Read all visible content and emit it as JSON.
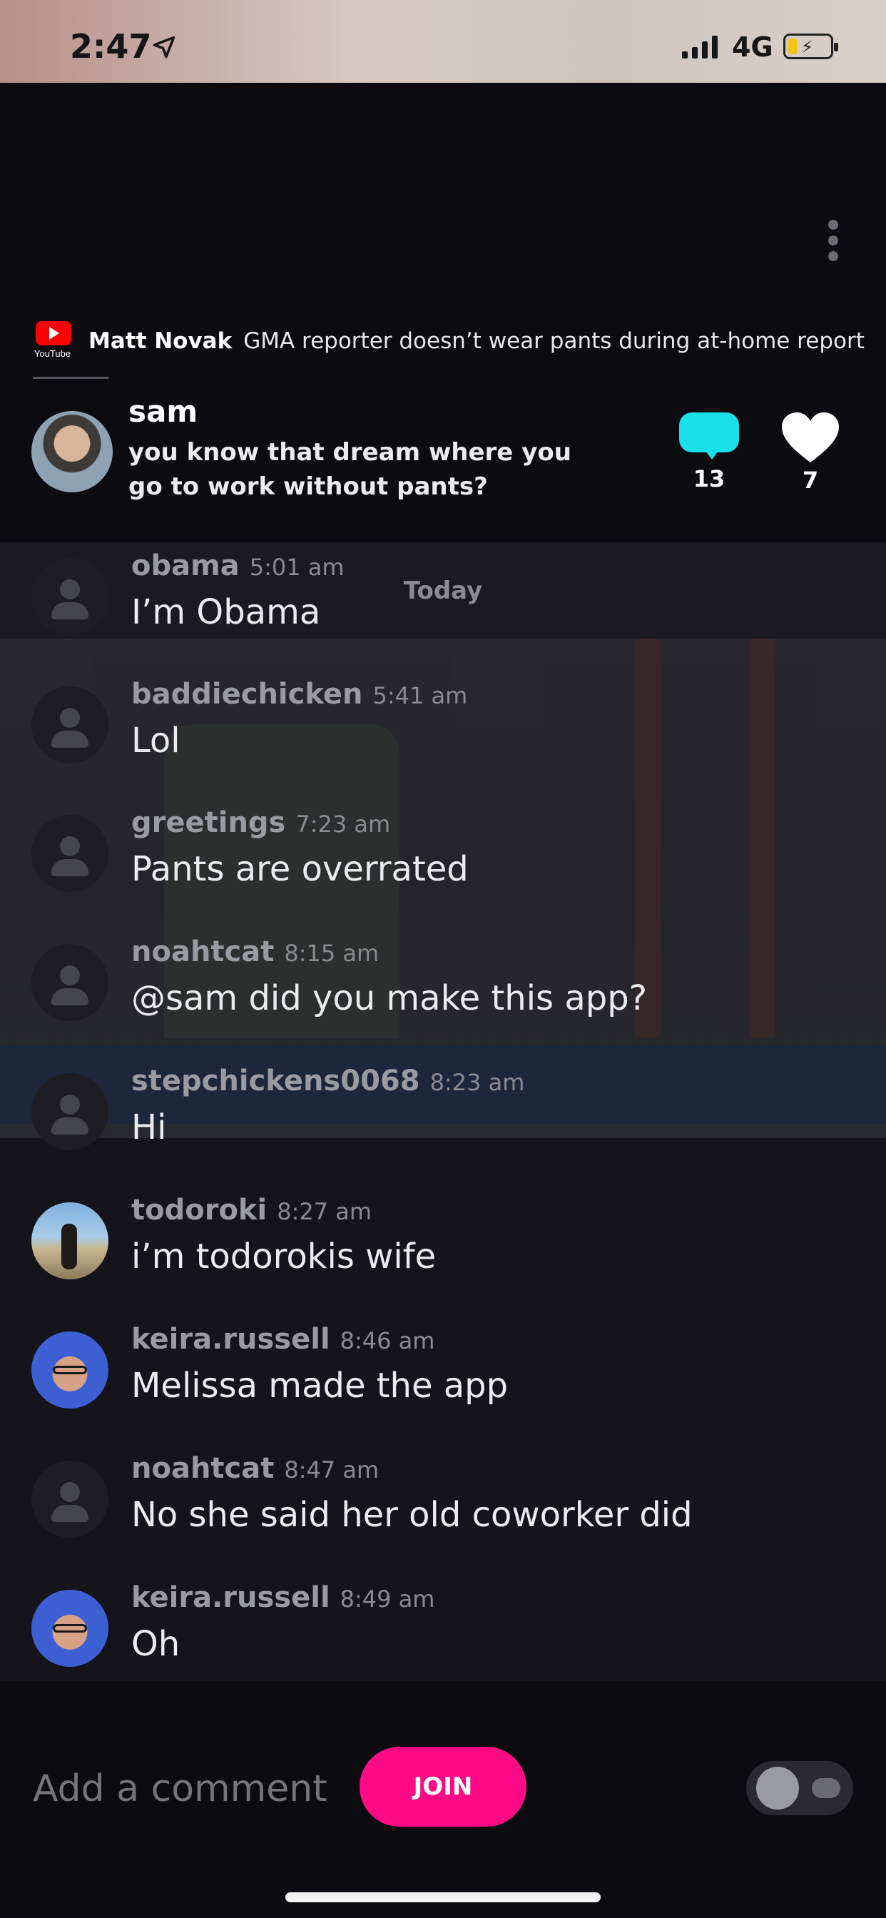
{
  "status_bar": {
    "time": "2:47",
    "network": "4G",
    "battery_level": 0.2
  },
  "source": {
    "platform_label": "YouTube",
    "author": "Matt Novak",
    "title": "GMA reporter doesn’t wear pants during at-home report"
  },
  "post": {
    "user": "sam",
    "text": "you know that dream where you go to work without pants?",
    "comment_count": "13",
    "like_count": "7"
  },
  "chat": {
    "day_label": "Today",
    "messages": [
      {
        "user": "obama",
        "time": "5:01 am",
        "text": "I’m Obama"
      },
      {
        "user": "baddiechicken",
        "time": "5:41 am",
        "text": "Lol"
      },
      {
        "user": "greetings",
        "time": "7:23 am",
        "text": "Pants are overrated"
      },
      {
        "user": "noahtcat",
        "time": "8:15 am",
        "text": "@sam did you make this app?"
      },
      {
        "user": "stepchickens0068",
        "time": "8:23 am",
        "text": "Hi"
      },
      {
        "user": "todoroki",
        "time": "8:27 am",
        "text": "i’m todorokis wife"
      },
      {
        "user": "keira.russell",
        "time": "8:46 am",
        "text": "Melissa made the app"
      },
      {
        "user": "noahtcat",
        "time": "8:47 am",
        "text": "No she said her old coworker did"
      },
      {
        "user": "keira.russell",
        "time": "8:49 am",
        "text": "Oh"
      }
    ]
  },
  "composer": {
    "placeholder": "Add a comment",
    "join_label": "JOIN"
  },
  "colors": {
    "accent_pink": "#ff0a86",
    "comment_bubble": "#18dfe8",
    "background": "#0b0b10"
  }
}
